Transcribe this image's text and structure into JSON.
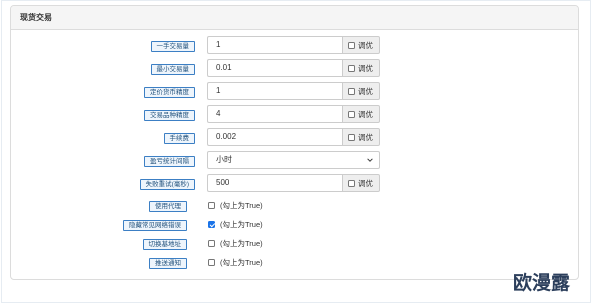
{
  "panel": {
    "title": "现货交易"
  },
  "fields": [
    {
      "label": "一手交易量",
      "value": "1",
      "addon": "调优"
    },
    {
      "label": "最小交易量",
      "value": "0.01",
      "addon": "调优"
    },
    {
      "label": "定价货币精度",
      "value": "1",
      "addon": "调优"
    },
    {
      "label": "交易品种精度",
      "value": "4",
      "addon": "调优"
    },
    {
      "label": "手续费",
      "value": "0.002",
      "addon": "调优"
    },
    {
      "label": "盈亏统计间隔",
      "select_value": "小时"
    },
    {
      "label": "失败重试(毫秒)",
      "value": "500",
      "addon": "调优"
    }
  ],
  "checks": [
    {
      "label": "使用代理",
      "text": "(勾上为True)",
      "checked": false
    },
    {
      "label": "隐藏常见网络错误",
      "text": "(勾上为True)",
      "checked": true
    },
    {
      "label": "切换基地址",
      "text": "(勾上为True)",
      "checked": false
    },
    {
      "label": "推送通知",
      "text": "(勾上为True)",
      "checked": false
    }
  ],
  "watermark": "欧漫露"
}
